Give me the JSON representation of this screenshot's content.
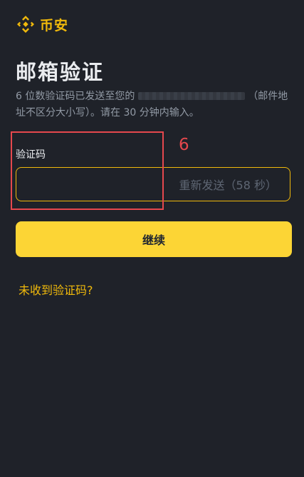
{
  "brand": {
    "name": "币安",
    "logo_icon": "binance-diamond-icon",
    "color": "#f0b90b"
  },
  "page": {
    "title": "邮箱验证",
    "description_before": "6 位数验证码已发送至您的",
    "description_after": "（邮件地址不区分大小写）。请在 30 分钟内输入。"
  },
  "code_field": {
    "label": "验证码",
    "value": "",
    "placeholder": "",
    "resend_label": "重新发送（58 秒）"
  },
  "annotation": {
    "label": "6",
    "color": "#e5484d"
  },
  "actions": {
    "continue_label": "继续",
    "no_code_link": "未收到验证码?"
  },
  "colors": {
    "background": "#1f2229",
    "accent": "#f0b90b",
    "button": "#fcd535"
  }
}
